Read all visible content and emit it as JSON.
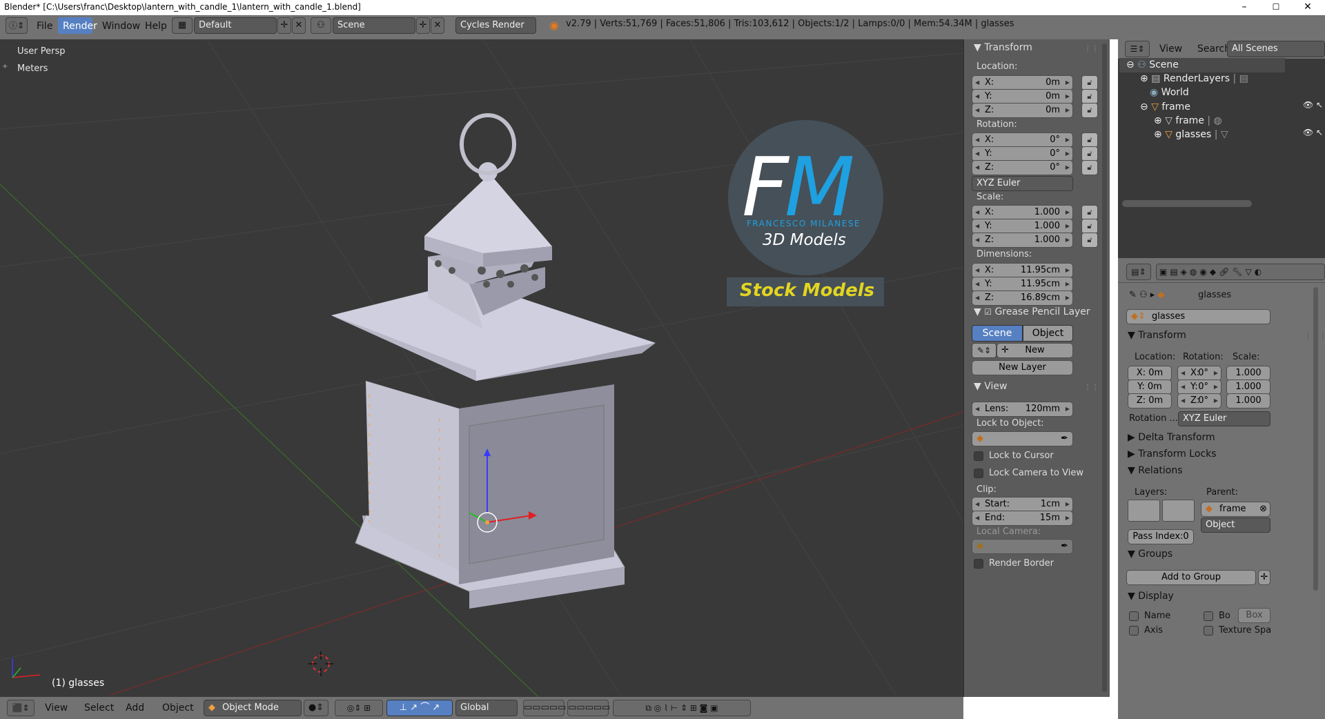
{
  "window": {
    "title": "Blender* [C:\\Users\\franc\\Desktop\\lantern_with_candle_1\\lantern_with_candle_1.blend]",
    "min": "–",
    "max": "☐",
    "close": "✕"
  },
  "topbar": {
    "menus": [
      "File",
      "Render",
      "Window",
      "Help"
    ],
    "layout": "Default",
    "scene": "Scene",
    "engine": "Cycles Render",
    "stats": "v2.79 | Verts:51,769 | Faces:51,806 | Tris:103,612 | Objects:1/2 | Lamps:0/0 | Mem:54.34M | glasses"
  },
  "viewport": {
    "persp": "User Persp",
    "units": "Meters",
    "selected": "(1) glasses",
    "logo": {
      "fm": "FM",
      "name": "FRANCESCO MILANESE",
      "sub": "3D Models",
      "badge": "Stock Models"
    }
  },
  "vheader": {
    "menus": [
      "View",
      "Select",
      "Add",
      "Object"
    ],
    "mode": "Object Mode",
    "orient": "Global"
  },
  "npanel": {
    "transform": "Transform",
    "location": "Location:",
    "rotation": "Rotation:",
    "scale": "Scale:",
    "dimensions": "Dimensions:",
    "loc": [
      {
        "a": "X:",
        "v": "0m"
      },
      {
        "a": "Y:",
        "v": "0m"
      },
      {
        "a": "Z:",
        "v": "0m"
      }
    ],
    "rot": [
      {
        "a": "X:",
        "v": "0°"
      },
      {
        "a": "Y:",
        "v": "0°"
      },
      {
        "a": "Z:",
        "v": "0°"
      }
    ],
    "rotmode": "XYZ Euler",
    "scl": [
      {
        "a": "X:",
        "v": "1.000"
      },
      {
        "a": "Y:",
        "v": "1.000"
      },
      {
        "a": "Z:",
        "v": "1.000"
      }
    ],
    "dim": [
      {
        "a": "X:",
        "v": "11.95cm"
      },
      {
        "a": "Y:",
        "v": "11.95cm"
      },
      {
        "a": "Z:",
        "v": "16.89cm"
      }
    ],
    "gp": "Grease Pencil Layer",
    "gp_scene": "Scene",
    "gp_object": "Object",
    "gp_new": "New",
    "gp_newlayer": "New Layer",
    "view": "View",
    "lens_l": "Lens:",
    "lens_v": "120mm",
    "lock_obj": "Lock to Object:",
    "lock_cursor": "Lock to Cursor",
    "lock_cam": "Lock Camera to View",
    "clip": "Clip:",
    "start_l": "Start:",
    "start_v": "1cm",
    "end_l": "End:",
    "end_v": "15m",
    "localcam": "Local Camera:",
    "renderborder": "Render Border"
  },
  "outliner": {
    "view": "View",
    "search": "Search",
    "scenes": "All Scenes",
    "items": [
      "Scene",
      "RenderLayers",
      "World",
      "frame",
      "frame",
      "glasses"
    ]
  },
  "props": {
    "objname": "glasses",
    "field": "glasses",
    "transform": "Transform",
    "loc_h": "Location:",
    "rot_h": "Rotation:",
    "scl_h": "Scale:",
    "loc": [
      "X: 0m",
      "Y: 0m",
      "Z: 0m"
    ],
    "rot": [
      {
        "a": "X:",
        "v": "0°"
      },
      {
        "a": "Y:",
        "v": "0°"
      },
      {
        "a": "Z:",
        "v": "0°"
      }
    ],
    "scl": [
      "1.000",
      "1.000",
      "1.000"
    ],
    "rotmode_l": "Rotation ...",
    "rotmode": "XYZ Euler",
    "delta": "Delta Transform",
    "locks": "Transform Locks",
    "relations": "Relations",
    "layers": "Layers:",
    "parent": "Parent:",
    "parent_v": "frame",
    "parent_type": "Object",
    "pass": "Pass Index:0",
    "groups": "Groups",
    "addgroup": "Add to Group",
    "display": "Display",
    "name": "Name",
    "bo": "Bo",
    "box": "Box",
    "axis": "Axis",
    "texspace": "Texture Spa"
  }
}
